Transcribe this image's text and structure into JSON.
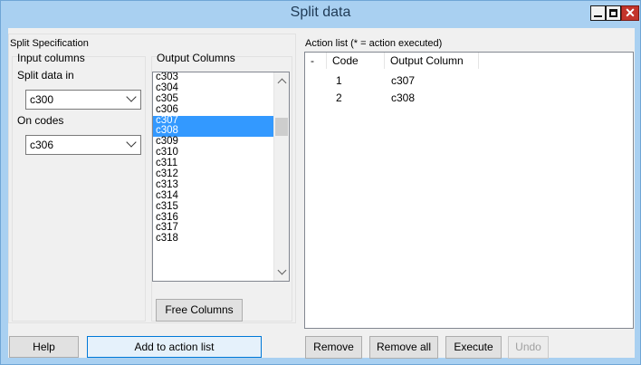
{
  "window": {
    "title": "Split data",
    "controls": {
      "minimize": "–",
      "maximize": "□",
      "close": "✕"
    }
  },
  "left_panel": {
    "title": "Split Specification",
    "input_columns": {
      "title": "Input columns",
      "split_label": "Split data in",
      "split_value": "c300",
      "codes_label": "On codes",
      "codes_value": "c306"
    },
    "output_columns": {
      "title": "Output Columns",
      "items": [
        "c303",
        "c304",
        "c305",
        "c306",
        "c307",
        "c308",
        "c309",
        "c310",
        "c311",
        "c312",
        "c313",
        "c314",
        "c315",
        "c316",
        "c317",
        "c318"
      ],
      "selected": [
        "c307",
        "c308"
      ],
      "free_button": "Free Columns"
    },
    "help_button": "Help",
    "add_button": "Add to action list"
  },
  "right_panel": {
    "title": "Action list (* = action executed)",
    "columns": [
      "-",
      "Code",
      "Output Column"
    ],
    "rows": [
      {
        "code": "1",
        "output": "c307"
      },
      {
        "code": "2",
        "output": "c308"
      }
    ],
    "buttons": {
      "remove": "Remove",
      "remove_all": "Remove all",
      "execute": "Execute",
      "undo": "Undo"
    }
  }
}
